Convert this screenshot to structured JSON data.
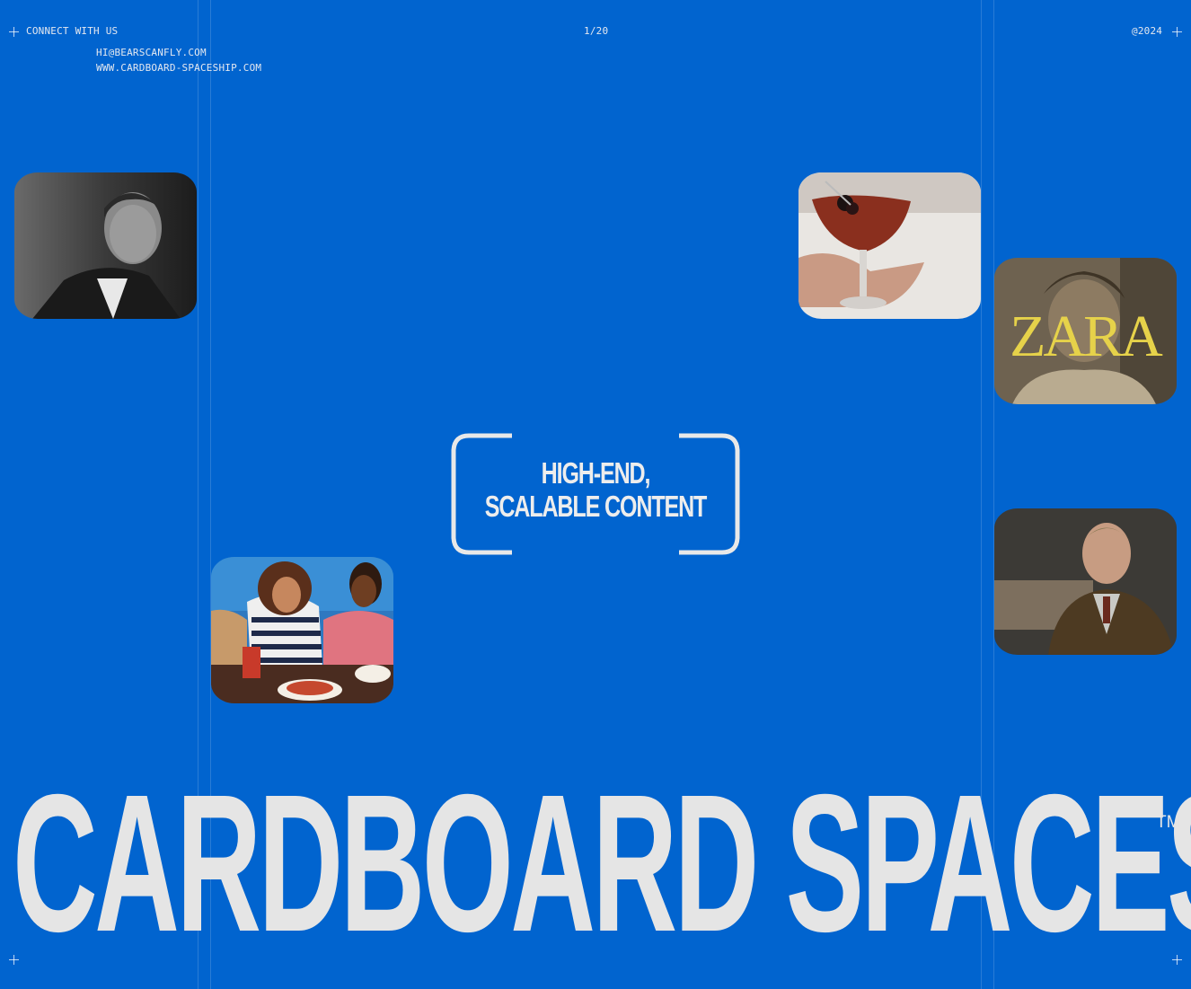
{
  "header": {
    "connect_label": "CONNECT WITH US",
    "email": "HI@BEARSCANFLY.COM",
    "website": "WWW.CARDBOARD-SPACESHIP.COM",
    "page_counter": "1/20",
    "copyright": "@2024"
  },
  "tagline": {
    "line1": "HIGH-END,",
    "line2": "SCALABLE CONTENT"
  },
  "brand": {
    "wordmark": "CARDBOARD SPACESHIP",
    "trademark": "TM"
  },
  "thumbnails": {
    "zara_logo_text": "ZARA"
  },
  "colors": {
    "background": "#0164CF",
    "text": "#E5E5E5"
  }
}
